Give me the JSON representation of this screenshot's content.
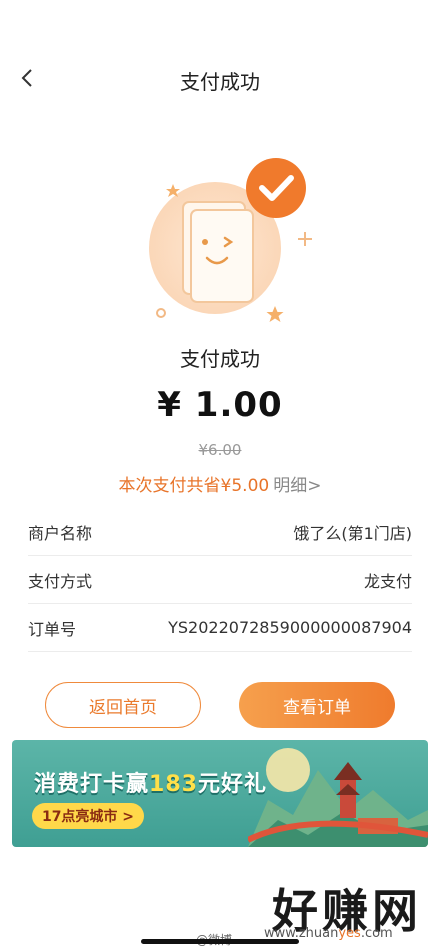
{
  "header": {
    "title": "支付成功",
    "back_icon": "chevron-left-icon"
  },
  "status": {
    "title": "支付成功",
    "amount": "¥ 1.00",
    "original_amount": "¥6.00",
    "saving_text": "本次支付共省¥5.00",
    "detail_link": "明细>"
  },
  "info": [
    {
      "label": "商户名称",
      "value": "饿了么(第1门店)"
    },
    {
      "label": "支付方式",
      "value": "龙支付"
    },
    {
      "label": "订单号",
      "value": "YS2022072859000000087904"
    }
  ],
  "buttons": {
    "home": "返回首页",
    "order": "查看订单"
  },
  "banner": {
    "title_prefix": "消费打卡赢",
    "title_number": "183",
    "title_suffix": "元好礼",
    "pill": "17点亮城市 >"
  },
  "watermark": {
    "text": "好赚网",
    "url_prefix": "www.zhuan",
    "url_highlight": "yes",
    "url_suffix": ".com",
    "weibo": "@微博"
  },
  "colors": {
    "accent": "#ef7b2d",
    "banner": "#4aa99c"
  }
}
